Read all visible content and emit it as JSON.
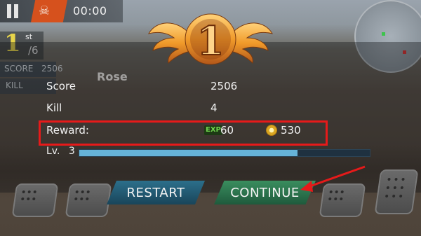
{
  "hud": {
    "timer": "00:00",
    "rank": "1",
    "rank_suffix": "st",
    "rank_total": "/6",
    "score_label": "SCORE",
    "score_value": "2506",
    "kill_label": "KILL"
  },
  "player_name": "Rose",
  "emblem": {
    "place": "1"
  },
  "results": {
    "score_label": "Score",
    "score_value": "2506",
    "kill_label": "Kill",
    "kill_value": "4",
    "reward_label": "Reward:",
    "exp_icon_text": "EXP",
    "exp_value": "60",
    "coin_value": "530",
    "level_label": "Lv.",
    "level_value": "3",
    "level_progress": 0.75
  },
  "buttons": {
    "restart": "RESTART",
    "continue": "CONTINUE"
  },
  "colors": {
    "highlight": "#e61a1a",
    "skull_tab": "#d6511d",
    "xp_fill": "#66b3d8"
  },
  "icons": {
    "pause": "pause-icon",
    "skull": "skull-icon",
    "exp": "exp-icon",
    "coin": "coin-icon",
    "dice": "dice-icon"
  }
}
